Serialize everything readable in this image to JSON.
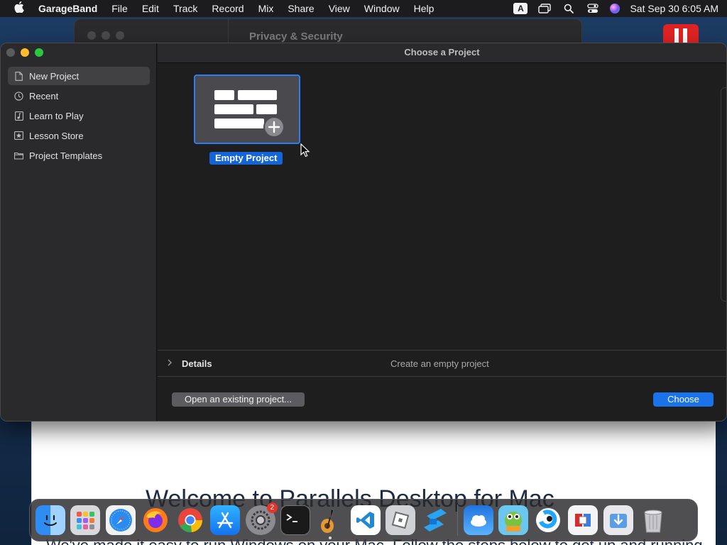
{
  "menubar": {
    "app_name": "GarageBand",
    "items": [
      "File",
      "Edit",
      "Track",
      "Record",
      "Mix",
      "Share",
      "View",
      "Window",
      "Help"
    ],
    "input_source": "A",
    "clock": "Sat Sep 30  6:05 AM"
  },
  "background_window": {
    "title": "Privacy & Security"
  },
  "background_doc": {
    "heading": "Welcome to Parallels Desktop for Mac",
    "subtext": "We've made it easy to run Windows on your Mac. Follow the steps below to get up and running."
  },
  "window": {
    "title": "Choose a Project",
    "sidebar": {
      "items": [
        {
          "label": "New Project",
          "icon": "document-icon",
          "active": true
        },
        {
          "label": "Recent",
          "icon": "clock-icon",
          "active": false
        },
        {
          "label": "Learn to Play",
          "icon": "music-note-icon",
          "active": false
        },
        {
          "label": "Lesson Store",
          "icon": "star-icon",
          "active": false
        },
        {
          "label": "Project Templates",
          "icon": "folder-icon",
          "active": false
        }
      ]
    },
    "tiles": [
      {
        "label": "Empty Project",
        "icon": "empty-project-add-icon",
        "selected": true
      }
    ],
    "details": {
      "label": "Details",
      "description": "Create an empty project"
    },
    "buttons": {
      "open_existing": "Open an existing project...",
      "choose": "Choose"
    }
  },
  "dock": {
    "apps": [
      {
        "name": "Finder",
        "icon": "finder-icon"
      },
      {
        "name": "Launchpad",
        "icon": "launchpad-icon"
      },
      {
        "name": "Safari",
        "icon": "safari-icon"
      },
      {
        "name": "Firefox",
        "icon": "firefox-icon"
      },
      {
        "name": "Chrome",
        "icon": "chrome-icon"
      },
      {
        "name": "App Store",
        "icon": "app-store-icon"
      },
      {
        "name": "System Settings",
        "icon": "system-settings-icon",
        "badge": "2"
      },
      {
        "name": "Terminal",
        "icon": "terminal-icon"
      },
      {
        "name": "GarageBand",
        "icon": "garageband-icon"
      },
      {
        "name": "Visual Studio Code",
        "icon": "vscode-icon"
      },
      {
        "name": "Roblox",
        "icon": "roblox-icon"
      },
      {
        "name": "Roblox Studio",
        "icon": "roblox-studio-icon"
      },
      {
        "name": "Weather",
        "icon": "weather-icon"
      },
      {
        "name": "Game",
        "icon": "game-icon"
      },
      {
        "name": "Camo",
        "icon": "camo-icon"
      },
      {
        "name": "Parallels Desktop",
        "icon": "parallels-icon"
      },
      {
        "name": "Downloads",
        "icon": "downloads-icon"
      },
      {
        "name": "Trash",
        "icon": "trash-icon"
      }
    ]
  }
}
